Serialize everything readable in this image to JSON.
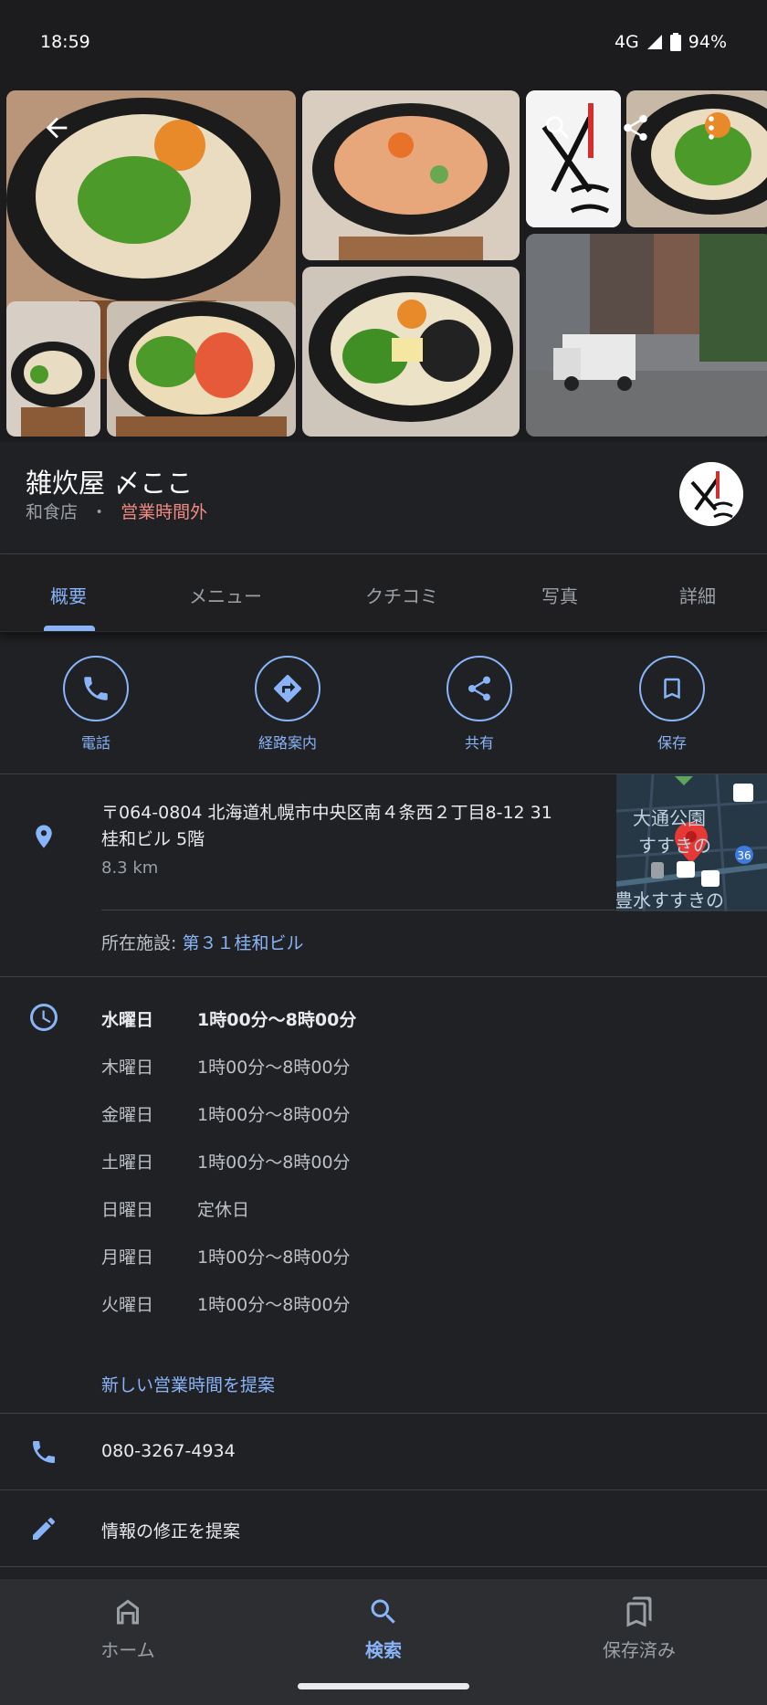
{
  "status_bar": {
    "time": "18:59",
    "network": "4G",
    "battery": "94%"
  },
  "gallery": {
    "logo_vertical_text": "〆ここ",
    "logo_small_text": "雑炊屋"
  },
  "place": {
    "name": "雑炊屋 〆ここ",
    "category": "和食店",
    "separator": "・",
    "status": "営業時間外"
  },
  "tabs": [
    "概要",
    "メニュー",
    "クチコミ",
    "写真",
    "詳細"
  ],
  "actions": [
    "電話",
    "経路案内",
    "共有",
    "保存"
  ],
  "address": {
    "line1": "〒064-0804 北海道札幌市中央区南４条西２丁目8-12 31",
    "line2": "桂和ビル 5階",
    "distance": "8.3 km",
    "map_labels": {
      "park": "大通公園",
      "area": "すすきの",
      "area2": "豊水すすきの",
      "route": "36"
    },
    "facility_label": "所在施設: ",
    "facility_link": "第３１桂和ビル"
  },
  "hours": [
    {
      "day": "水曜日",
      "time": "1時00分～8時00分",
      "today": true
    },
    {
      "day": "木曜日",
      "time": "1時00分～8時00分",
      "today": false
    },
    {
      "day": "金曜日",
      "time": "1時00分～8時00分",
      "today": false
    },
    {
      "day": "土曜日",
      "time": "1時00分～8時00分",
      "today": false
    },
    {
      "day": "日曜日",
      "time": "定休日",
      "today": false
    },
    {
      "day": "月曜日",
      "time": "1時00分～8時00分",
      "today": false
    },
    {
      "day": "火曜日",
      "time": "1時00分～8時00分",
      "today": false
    }
  ],
  "suggest_hours": "新しい営業時間を提案",
  "phone": "080-3267-4934",
  "suggest_edit": "情報の修正を提案",
  "bottom_nav": [
    "ホーム",
    "検索",
    "保存済み"
  ],
  "colors": {
    "accent": "#8ab4f8",
    "closed": "#f28b82",
    "background": "#202124"
  }
}
